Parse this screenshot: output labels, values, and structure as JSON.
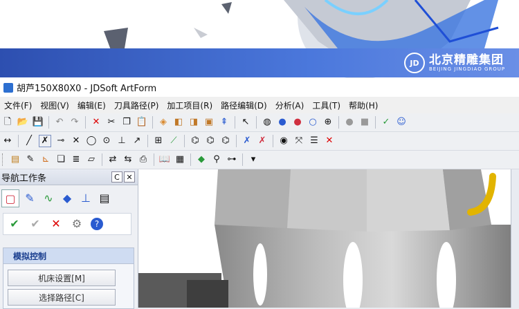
{
  "banner": {
    "brand_cn": "北京精雕集团",
    "brand_en": "BEIJING JINGDIAO GROUP",
    "logo_letters": "JD",
    "colors": {
      "band": "#3a64c8"
    }
  },
  "titlebar": {
    "title": "胡芦150X80X0 - JDSoft ArtForm"
  },
  "menu": {
    "items": [
      "文件(F)",
      "视图(V)",
      "编辑(E)",
      "刀具路径(P)",
      "加工项目(R)",
      "路径编辑(D)",
      "分析(A)",
      "工具(T)",
      "帮助(H)"
    ]
  },
  "toolbar1": [
    "new-file-icon",
    "open-folder-icon",
    "save-icon",
    "undo-icon",
    "redo-icon",
    "delete-icon",
    "cut-icon",
    "copy-icon",
    "paste-icon",
    "box-view-icon",
    "iso-view-icon",
    "front-view-icon",
    "side-view-icon",
    "axis-icon",
    "select-icon",
    "sphere-wire-icon",
    "sphere-shaded-icon",
    "sphere-red-icon",
    "sphere-outline-icon",
    "sphere-grid-icon",
    "sphere-gray-icon",
    "cube-gray-icon",
    "tool-mark-icon",
    "user-icon"
  ],
  "toolbar2": [
    "move-icon",
    "line-icon",
    "trim-icon",
    "point-icon",
    "cross-icon",
    "circle-icon",
    "target-icon",
    "ruler-icon",
    "arrow-icon",
    "grid-icon",
    "chart-icon",
    "surface1-icon",
    "surface2-icon",
    "surface3-icon",
    "tool1-icon",
    "tool2-icon",
    "view1-icon",
    "view2-icon",
    "view3-icon",
    "close-red-icon"
  ],
  "toolbar3": [
    "list-icon",
    "edit-icon",
    "axis-small-icon",
    "layers-icon",
    "stack-icon",
    "eraser-icon",
    "path1-icon",
    "path2-icon",
    "printer-icon",
    "book-icon",
    "table-icon",
    "cube-green-icon",
    "stamp-icon",
    "tree-icon",
    "overflow-icon"
  ],
  "nav": {
    "title": "导航工作条",
    "pin_label": "C",
    "close_label": "✕",
    "icon_row": [
      "layer-icon",
      "brush-icon",
      "path-icon",
      "diamond-icon",
      "stamp-icon",
      "export-icon"
    ],
    "actions": [
      {
        "name": "confirm-icon",
        "glyph": "✔"
      },
      {
        "name": "confirm-gray-icon",
        "glyph": "✔"
      },
      {
        "name": "cancel-icon",
        "glyph": "✕"
      },
      {
        "name": "tool-icon",
        "glyph": "⚙"
      },
      {
        "name": "help-icon",
        "glyph": "?"
      }
    ],
    "section_title": "模拟控制",
    "buttons": [
      "机床设置[M]",
      "选择路径[C]"
    ]
  }
}
